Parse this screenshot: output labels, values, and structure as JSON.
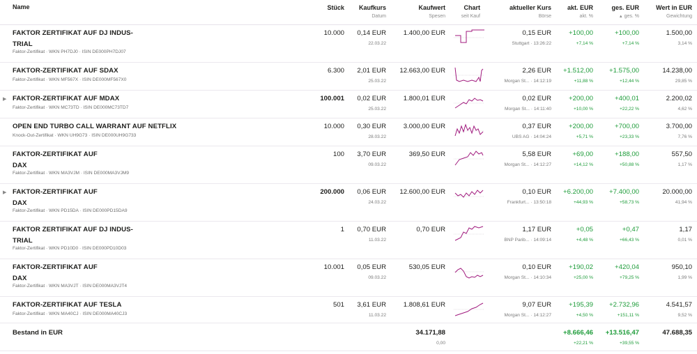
{
  "headers": {
    "name": "Name",
    "stueck": "Stück",
    "kaufkurs": "Kaufkurs",
    "kaufkurs_sub": "Datum",
    "kaufwert": "Kaufwert",
    "kaufwert_sub": "Spesen",
    "chart": "Chart",
    "chart_sub": "seit Kauf",
    "kurs": "aktueller Kurs",
    "kurs_sub": "Börse",
    "akt": "akt. EUR",
    "akt_sub": "akt. %",
    "ges": "ges. EUR",
    "ges_sub": "ges. %",
    "wert": "Wert in EUR",
    "wert_sub": "Gewichtung"
  },
  "rows": [
    {
      "title1": "FAKTOR ZERTIFIKAT AUF DJ INDUS-",
      "title2": "TRIAL",
      "sub": "Faktor-Zertifikat · WKN PH7DJ0 · ISIN DE000PH7DJ07",
      "expand": false,
      "stueck": "10.000",
      "stueck_bold": false,
      "kaufkurs": "0,14 EUR",
      "datum": "22.03.22",
      "kaufwert": "1.400,00 EUR",
      "spesen": "",
      "kurs": "0,15 EUR",
      "boerse": "Stuttgart · 13:26:22",
      "akt_eur": "+100,00",
      "akt_pct": "+7,14 %",
      "ges_eur": "+100,00",
      "ges_pct": "+7,14 %",
      "wert": "1.500,00",
      "gewicht": "3,14 %"
    },
    {
      "title1": "FAKTOR-ZERTIFIKAT AUF SDAX",
      "title2": "",
      "sub": "Faktor-Zertifikat · WKN MF567X · ISIN DE000MF567X0",
      "expand": false,
      "stueck": "6.300",
      "stueck_bold": false,
      "kaufkurs": "2,01 EUR",
      "datum": "25.03.22",
      "kaufwert": "12.663,00 EUR",
      "spesen": "",
      "kurs": "2,26 EUR",
      "boerse": "Morgan St... · 14:12:19",
      "akt_eur": "+1.512,00",
      "akt_pct": "+11,88 %",
      "ges_eur": "+1.575,00",
      "ges_pct": "+12,44 %",
      "wert": "14.238,00",
      "gewicht": "29,85 %"
    },
    {
      "title1": "FAKTOR-ZERTIFIKAT AUF MDAX",
      "title2": "",
      "sub": "Faktor-Zertifikat · WKN MC73TD · ISIN DE000MC73TD7",
      "expand": true,
      "stueck": "100.001",
      "stueck_bold": true,
      "kaufkurs": "0,02 EUR",
      "datum": "25.03.22",
      "kaufwert": "1.800,01 EUR",
      "spesen": "",
      "kurs": "0,02 EUR",
      "boerse": "Morgan St... · 14:11:40",
      "akt_eur": "+200,00",
      "akt_pct": "+10,00 %",
      "ges_eur": "+400,01",
      "ges_pct": "+22,22 %",
      "wert": "2.200,02",
      "gewicht": "4,62 %"
    },
    {
      "title1": "OPEN END TURBO CALL WARRANT AUF NETFLIX",
      "title2": "",
      "sub": "Knock-Out-Zertifikat · WKN UH9G73 · ISIN DE000UH9G733",
      "expand": false,
      "stueck": "10.000",
      "stueck_bold": false,
      "kaufkurs": "0,30 EUR",
      "datum": "28.03.22",
      "kaufwert": "3.000,00 EUR",
      "spesen": "",
      "kurs": "0,37 EUR",
      "boerse": "UBS AG · 14:04:24",
      "akt_eur": "+200,00",
      "akt_pct": "+5,71 %",
      "ges_eur": "+700,00",
      "ges_pct": "+23,33 %",
      "wert": "3.700,00",
      "gewicht": "7,76 %"
    },
    {
      "title1": "FAKTOR-ZERTIFIKAT AUF",
      "title2": "DAX",
      "sub": "Faktor-Zertifikat · WKN MA3VJM · ISIN DE000MA3VJM9",
      "expand": false,
      "stueck": "100",
      "stueck_bold": false,
      "kaufkurs": "3,70 EUR",
      "datum": "09.03.22",
      "kaufwert": "369,50 EUR",
      "spesen": "",
      "kurs": "5,58 EUR",
      "boerse": "Morgan St... · 14:12:27",
      "akt_eur": "+69,00",
      "akt_pct": "+14,12 %",
      "ges_eur": "+188,00",
      "ges_pct": "+50,88 %",
      "wert": "557,50",
      "gewicht": "1,17 %"
    },
    {
      "title1": "FAKTOR-ZERTIFIKAT AUF",
      "title2": "DAX",
      "sub": "Faktor-Zertifikat · WKN PD15DA · ISIN DE000PD15DA9",
      "expand": true,
      "stueck": "200.000",
      "stueck_bold": true,
      "kaufkurs": "0,06 EUR",
      "datum": "24.03.22",
      "kaufwert": "12.600,00 EUR",
      "spesen": "",
      "kurs": "0,10 EUR",
      "boerse": "Frankfurt... · 13:50:18",
      "akt_eur": "+6.200,00",
      "akt_pct": "+44,93 %",
      "ges_eur": "+7.400,00",
      "ges_pct": "+58,73 %",
      "wert": "20.000,00",
      "gewicht": "41,94 %"
    },
    {
      "title1": "FAKTOR ZERTIFIKAT AUF DJ INDUS-",
      "title2": "TRIAL",
      "sub": "Faktor-Zertifikat · WKN PD10D0 · ISIN DE000PD10D03",
      "expand": false,
      "stueck": "1",
      "stueck_bold": false,
      "kaufkurs": "0,70 EUR",
      "datum": "11.03.22",
      "kaufwert": "0,70 EUR",
      "spesen": "",
      "kurs": "1,17 EUR",
      "boerse": "BNP Parib... · 14:09:14",
      "akt_eur": "+0,05",
      "akt_pct": "+4,48 %",
      "ges_eur": "+0,47",
      "ges_pct": "+66,43 %",
      "wert": "1,17",
      "gewicht": "0,01 %"
    },
    {
      "title1": "FAKTOR-ZERTIFIKAT AUF",
      "title2": "DAX",
      "sub": "Faktor-Zertifikat · WKN MA3VJT · ISIN DE000MA3VJT4",
      "expand": false,
      "stueck": "10.001",
      "stueck_bold": false,
      "kaufkurs": "0,05 EUR",
      "datum": "09.03.22",
      "kaufwert": "530,05 EUR",
      "spesen": "",
      "kurs": "0,10 EUR",
      "boerse": "Morgan St... · 14:10:34",
      "akt_eur": "+190,02",
      "akt_pct": "+25,00 %",
      "ges_eur": "+420,04",
      "ges_pct": "+79,25 %",
      "wert": "950,10",
      "gewicht": "1,99 %"
    },
    {
      "title1": "FAKTOR-ZERTIFIKAT AUF TESLA",
      "title2": "",
      "sub": "Faktor-Zertifikat · WKN MA40CJ · ISIN DE000MA40CJ3",
      "expand": false,
      "stueck": "501",
      "stueck_bold": false,
      "kaufkurs": "3,61 EUR",
      "datum": "11.03.22",
      "kaufwert": "1.808,61 EUR",
      "spesen": "",
      "kurs": "9,07 EUR",
      "boerse": "Morgan St... · 14:12:27",
      "akt_eur": "+195,39",
      "akt_pct": "+4,50 %",
      "ges_eur": "+2.732,96",
      "ges_pct": "+151,11 %",
      "wert": "4.541,57",
      "gewicht": "9,52 %"
    }
  ],
  "total": {
    "label": "Bestand in EUR",
    "kaufwert": "34.171,88",
    "spesen": "0,00",
    "akt_eur": "+8.666,46",
    "akt_pct": "+22,21 %",
    "ges_eur": "+13.516,47",
    "ges_pct": "+39,55 %",
    "wert": "47.688,35"
  },
  "colors": {
    "chart_line": "#a0197d",
    "positive": "#1e9c3a",
    "text": "#1d1d1b",
    "muted": "#7a7a7a"
  }
}
